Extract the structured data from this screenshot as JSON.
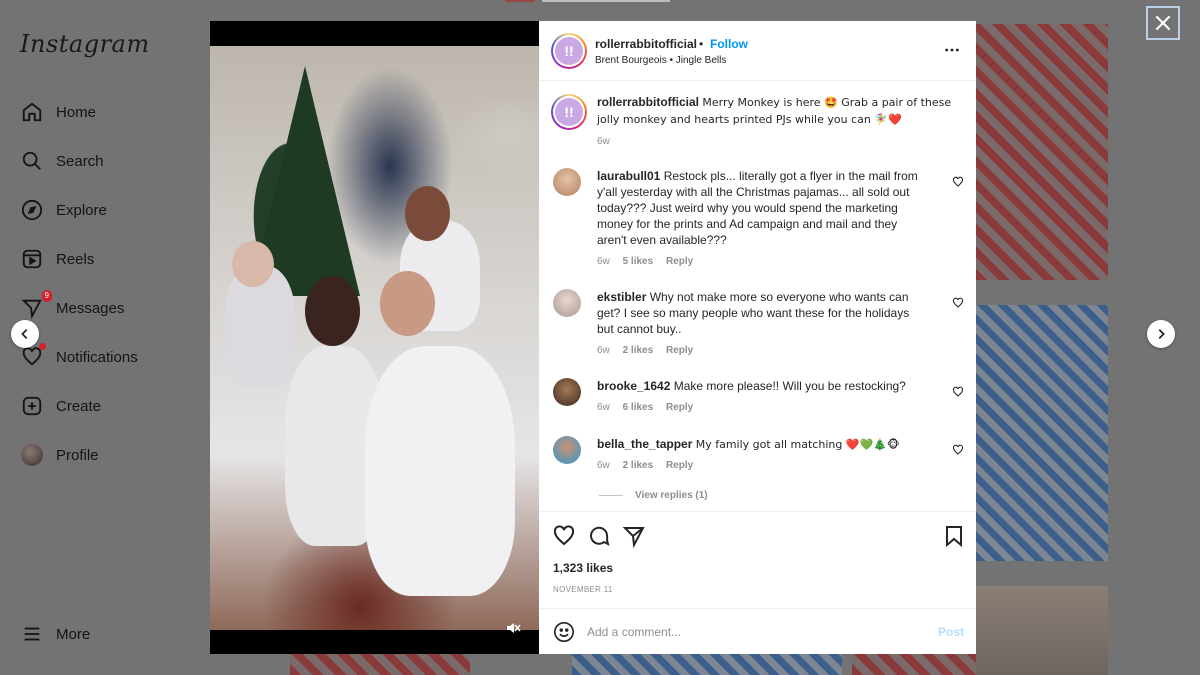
{
  "app": {
    "logo": "Instagram"
  },
  "sidebar": {
    "items": [
      {
        "label": "Home",
        "icon": "home-icon"
      },
      {
        "label": "Search",
        "icon": "search-icon"
      },
      {
        "label": "Explore",
        "icon": "compass-icon"
      },
      {
        "label": "Reels",
        "icon": "reels-icon"
      },
      {
        "label": "Messages",
        "icon": "messenger-icon",
        "badge": "9"
      },
      {
        "label": "Notifications",
        "icon": "heart-icon"
      },
      {
        "label": "Create",
        "icon": "plus-square-icon"
      },
      {
        "label": "Profile",
        "icon": "avatar"
      }
    ],
    "more_label": "More"
  },
  "post": {
    "header": {
      "username": "rollerrabbitofficial",
      "separator": "•",
      "follow_label": "Follow",
      "audio": "Brent Bourgeois • Jingle Bells"
    },
    "caption": {
      "username": "rollerrabbitofficial",
      "text": "Merry Monkey is here 🤩 Grab a pair of these jolly monkey and hearts printed PJs while you can 🧚‍♀️❤️",
      "time": "6w"
    },
    "comments": [
      {
        "username": "laurabull01",
        "text": "Restock pls... literally got a flyer in the mail from y'all yesterday with all the Christmas pajamas... all sold out today??? Just weird why you would spend the marketing money for the prints and Ad campaign and mail and they aren't even available???",
        "time": "6w",
        "likes": "5 likes",
        "reply": "Reply"
      },
      {
        "username": "ekstibler",
        "text": "Why not make more so everyone who wants can get? I see so many people who want these for the holidays but cannot buy..",
        "time": "6w",
        "likes": "2 likes",
        "reply": "Reply"
      },
      {
        "username": "brooke_1642",
        "text": "Make more please!! Will you be restocking?",
        "time": "6w",
        "likes": "6 likes",
        "reply": "Reply"
      },
      {
        "username": "bella_the_tapper",
        "text": "My family got all matching ❤️💚🎄🐵",
        "time": "6w",
        "likes": "2 likes",
        "reply": "Reply"
      }
    ],
    "view_replies": "View replies (1)",
    "likes": "1,323 likes",
    "date": "NOVEMBER 11",
    "add_comment": {
      "placeholder": "Add a comment...",
      "post_label": "Post"
    }
  },
  "colors": {
    "accent": "#0095f6",
    "post_disabled": "#b2dffc",
    "badge": "#d51f2a"
  }
}
